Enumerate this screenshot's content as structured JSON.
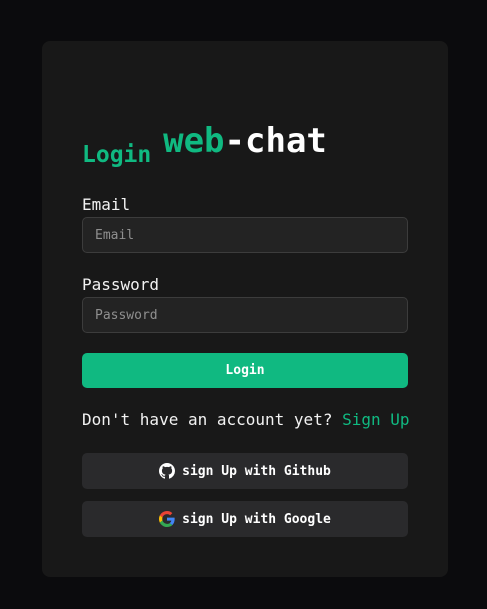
{
  "brand": {
    "part1": "web",
    "part2": "-chat",
    "accent_color": "#10b981"
  },
  "form": {
    "heading": "Login",
    "email_label": "Email",
    "email_placeholder": "Email",
    "password_label": "Password",
    "password_placeholder": "Password",
    "submit_label": "Login"
  },
  "signup": {
    "prompt": "Don't have an account yet?",
    "link": "Sign Up"
  },
  "oauth": {
    "github": {
      "label": "sign Up with Github",
      "icon": "github-icon"
    },
    "google": {
      "label": "sign Up with Google",
      "icon": "google-icon"
    }
  }
}
